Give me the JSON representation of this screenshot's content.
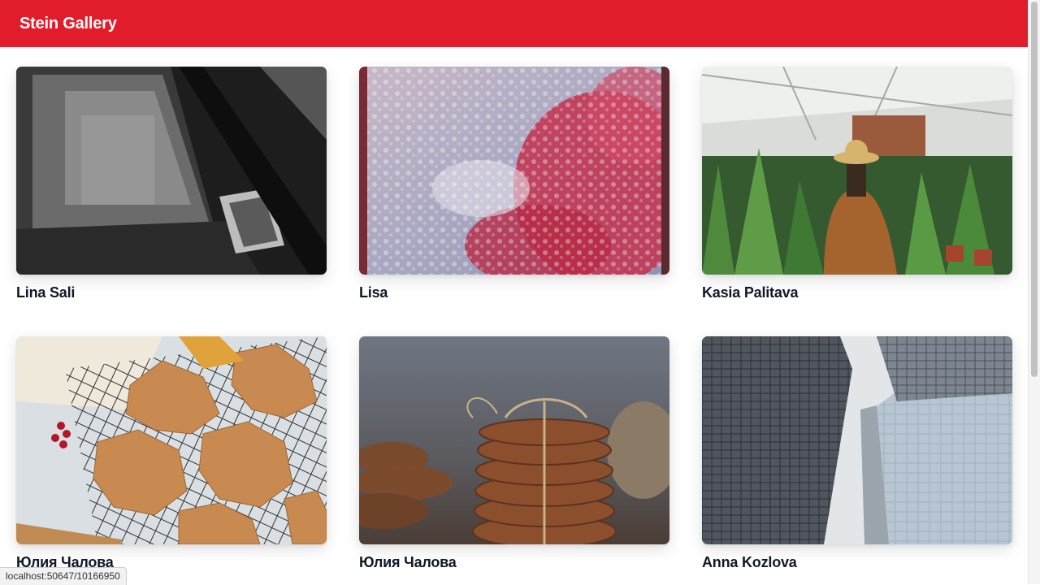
{
  "header": {
    "brand": "Stein Gallery",
    "brand_color": "#e21d2b"
  },
  "gallery": {
    "items": [
      {
        "author": "Lina Sali",
        "image": "car-window-bw-photo"
      },
      {
        "author": "Lisa",
        "image": "rain-window-red-leaves-photo"
      },
      {
        "author": "Kasia Palitava",
        "image": "greenhouse-woman-hat-photo"
      },
      {
        "author": "Юлия Чалова",
        "image": "maple-leaf-cookies-photo"
      },
      {
        "author": "Юлия Чалова",
        "image": "sesame-cookie-stack-photo"
      },
      {
        "author": "Anna Kozlova",
        "image": "skyscrapers-looking-up-photo"
      }
    ]
  },
  "status": {
    "url": "localhost:50647/10166950"
  }
}
